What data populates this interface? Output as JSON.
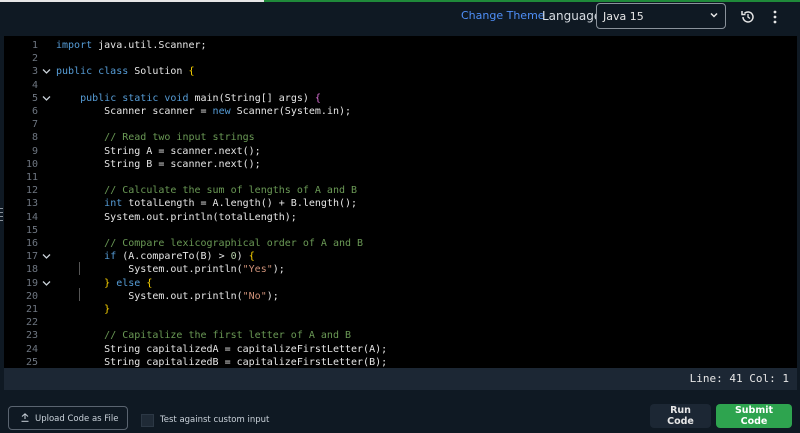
{
  "header": {
    "change_theme": "Change Theme",
    "language_label": "Language",
    "language_selected": "Java 15",
    "progress_fraction": 0.33
  },
  "editor": {
    "lines": [
      {
        "n": "1",
        "tokens": [
          [
            "kw",
            "import"
          ],
          [
            "pl",
            " java.util.Scanner;"
          ]
        ]
      },
      {
        "n": "2",
        "tokens": []
      },
      {
        "n": "3",
        "fold": true,
        "tokens": [
          [
            "kw",
            "public class"
          ],
          [
            "pl",
            " Solution "
          ],
          [
            "br1",
            "{"
          ]
        ]
      },
      {
        "n": "4",
        "tokens": []
      },
      {
        "n": "5",
        "fold": true,
        "tokens": [
          [
            "pl",
            "    "
          ],
          [
            "kw",
            "public static void"
          ],
          [
            "pl",
            " main(String[] args) "
          ],
          [
            "br2",
            "{"
          ]
        ]
      },
      {
        "n": "6",
        "tokens": [
          [
            "pl",
            "        Scanner scanner = "
          ],
          [
            "kw",
            "new"
          ],
          [
            "pl",
            " Scanner(System.in);"
          ]
        ]
      },
      {
        "n": "7",
        "tokens": []
      },
      {
        "n": "8",
        "tokens": [
          [
            "pl",
            "        "
          ],
          [
            "cm",
            "// Read two input strings"
          ]
        ]
      },
      {
        "n": "9",
        "tokens": [
          [
            "pl",
            "        String A = scanner.next();"
          ]
        ]
      },
      {
        "n": "10",
        "tokens": [
          [
            "pl",
            "        String B = scanner.next();"
          ]
        ]
      },
      {
        "n": "11",
        "tokens": []
      },
      {
        "n": "12",
        "tokens": [
          [
            "pl",
            "        "
          ],
          [
            "cm",
            "// Calculate the sum of lengths of A and B"
          ]
        ]
      },
      {
        "n": "13",
        "tokens": [
          [
            "pl",
            "        "
          ],
          [
            "kw",
            "int"
          ],
          [
            "pl",
            " totalLength = A.length() + B.length();"
          ]
        ]
      },
      {
        "n": "14",
        "tokens": [
          [
            "pl",
            "        System.out.println(totalLength);"
          ]
        ]
      },
      {
        "n": "15",
        "tokens": []
      },
      {
        "n": "16",
        "tokens": [
          [
            "pl",
            "        "
          ],
          [
            "cm",
            "// Compare lexicographical order of A and B"
          ]
        ]
      },
      {
        "n": "17",
        "fold": true,
        "tokens": [
          [
            "pl",
            "        "
          ],
          [
            "kw",
            "if"
          ],
          [
            "pl",
            " (A.compareTo(B) > "
          ],
          [
            "nm",
            "0"
          ],
          [
            "pl",
            ") "
          ],
          [
            "br1",
            "{"
          ]
        ]
      },
      {
        "n": "18",
        "tokens": [
          [
            "pl",
            "            System.out.println("
          ],
          [
            "st",
            "\"Yes\""
          ],
          [
            "pl",
            ");"
          ]
        ]
      },
      {
        "n": "19",
        "fold": true,
        "tokens": [
          [
            "pl",
            "        "
          ],
          [
            "br1",
            "}"
          ],
          [
            "pl",
            " "
          ],
          [
            "kw",
            "else"
          ],
          [
            "pl",
            " "
          ],
          [
            "br1",
            "{"
          ]
        ]
      },
      {
        "n": "20",
        "tokens": [
          [
            "pl",
            "            System.out.println("
          ],
          [
            "st",
            "\"No\""
          ],
          [
            "pl",
            ");"
          ]
        ]
      },
      {
        "n": "21",
        "tokens": [
          [
            "pl",
            "        "
          ],
          [
            "br1",
            "}"
          ]
        ]
      },
      {
        "n": "22",
        "tokens": []
      },
      {
        "n": "23",
        "tokens": [
          [
            "pl",
            "        "
          ],
          [
            "cm",
            "// Capitalize the first letter of A and B"
          ]
        ]
      },
      {
        "n": "24",
        "tokens": [
          [
            "pl",
            "        String capitalizedA = capitalizeFirstLetter(A);"
          ]
        ]
      },
      {
        "n": "25",
        "tokens": [
          [
            "pl",
            "        String capitalizedB = capitalizeFirstLetter(B);"
          ]
        ]
      }
    ]
  },
  "status": {
    "position": "Line: 41 Col: 1"
  },
  "footer": {
    "upload_label": "Upload Code as File",
    "custom_input_label": "Test against custom input",
    "run_label": "Run Code",
    "submit_label": "Submit Code"
  },
  "colors": {
    "accent_green": "#2ea44f",
    "link_blue": "#4f8ff7",
    "editor_bg": "#000000"
  }
}
